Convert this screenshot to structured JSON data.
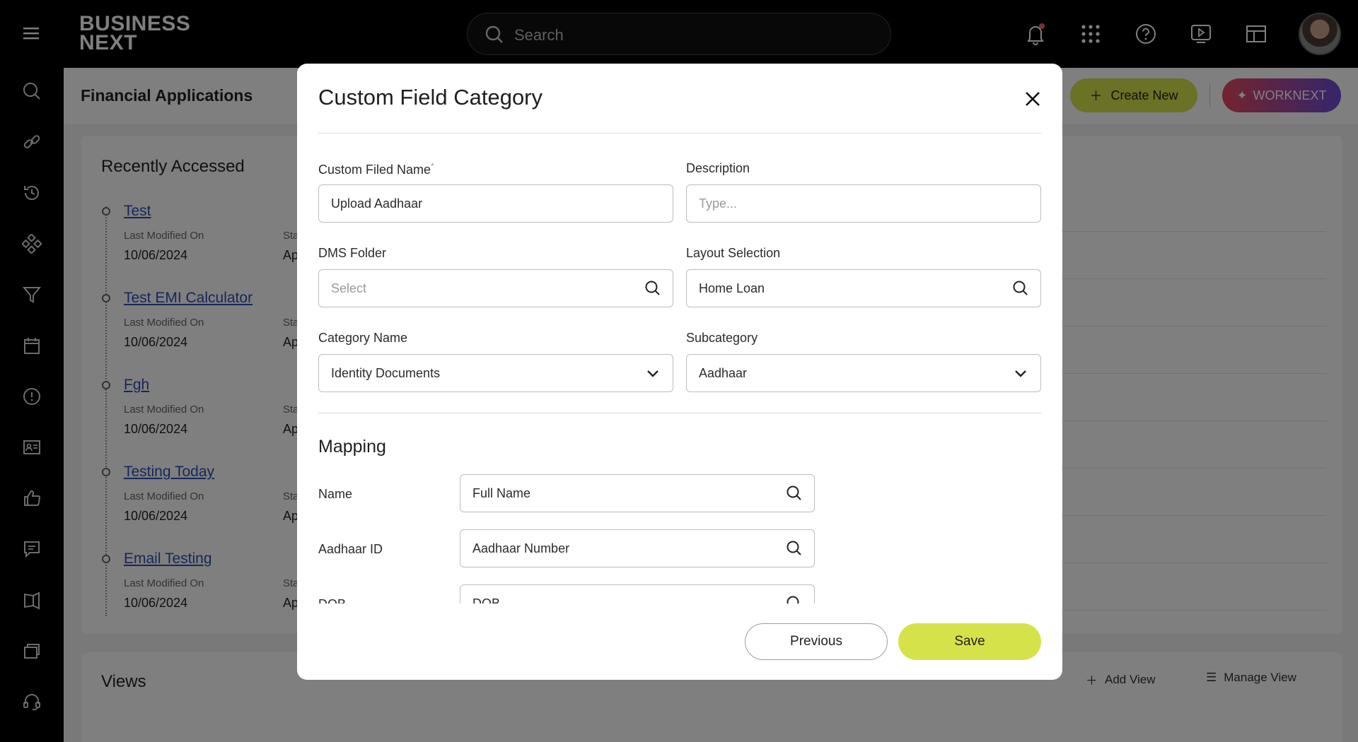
{
  "topbar": {
    "logo_line1": "BUSINESS",
    "logo_line2": "NEXT",
    "search_placeholder": "Search",
    "icons": [
      "bell-icon",
      "apps-grid-icon",
      "help-icon",
      "play-video-icon",
      "layout-icon"
    ]
  },
  "page": {
    "title": "Financial Applications",
    "create_new_label": "Create New",
    "worknext_label": "WORKNEXT"
  },
  "recently_accessed": {
    "title": "Recently Accessed",
    "items": [
      {
        "name": "Test",
        "modified_label": "Last Modified On",
        "modified": "10/06/2024",
        "status_label": "Sta",
        "status": "Ap"
      },
      {
        "name": "Test EMI Calculator",
        "modified_label": "Last Modified On",
        "modified": "10/06/2024",
        "status_label": "Sta",
        "status": "Ap"
      },
      {
        "name": "Fgh",
        "modified_label": "Last Modified On",
        "modified": "10/06/2024",
        "status_label": "Sta",
        "status": "Ap"
      },
      {
        "name": "Testing Today",
        "modified_label": "Last Modified On",
        "modified": "10/06/2024",
        "status_label": "Sta",
        "status": "Ap"
      },
      {
        "name": "Email Testing",
        "modified_label": "Last Modified On",
        "modified": "10/06/2024",
        "status_label": "Sta",
        "status": "Ap"
      }
    ]
  },
  "views": {
    "title": "Views",
    "add_view_label": "Add View",
    "manage_view_label": "Manage View"
  },
  "modal": {
    "title": "Custom Field Category",
    "fields": {
      "custom_field_name": {
        "label": "Custom Filed Name",
        "required_mark": "*",
        "value": "Upload Aadhaar"
      },
      "description": {
        "label": "Description",
        "placeholder": "Type..."
      },
      "dms_folder": {
        "label": "DMS Folder",
        "placeholder": "Select"
      },
      "layout_selection": {
        "label": "Layout Selection",
        "value": "Home Loan"
      },
      "category_name": {
        "label": "Category Name",
        "value": "Identity Documents"
      },
      "subcategory": {
        "label": "Subcategory",
        "value": "Aadhaar"
      }
    },
    "mapping": {
      "title": "Mapping",
      "rows": [
        {
          "label": "Name",
          "value": "Full Name"
        },
        {
          "label": "Aadhaar ID",
          "value": "Aadhaar Number"
        },
        {
          "label": "DOB",
          "value": "DOB"
        }
      ]
    },
    "previous_label": "Previous",
    "save_label": "Save"
  }
}
